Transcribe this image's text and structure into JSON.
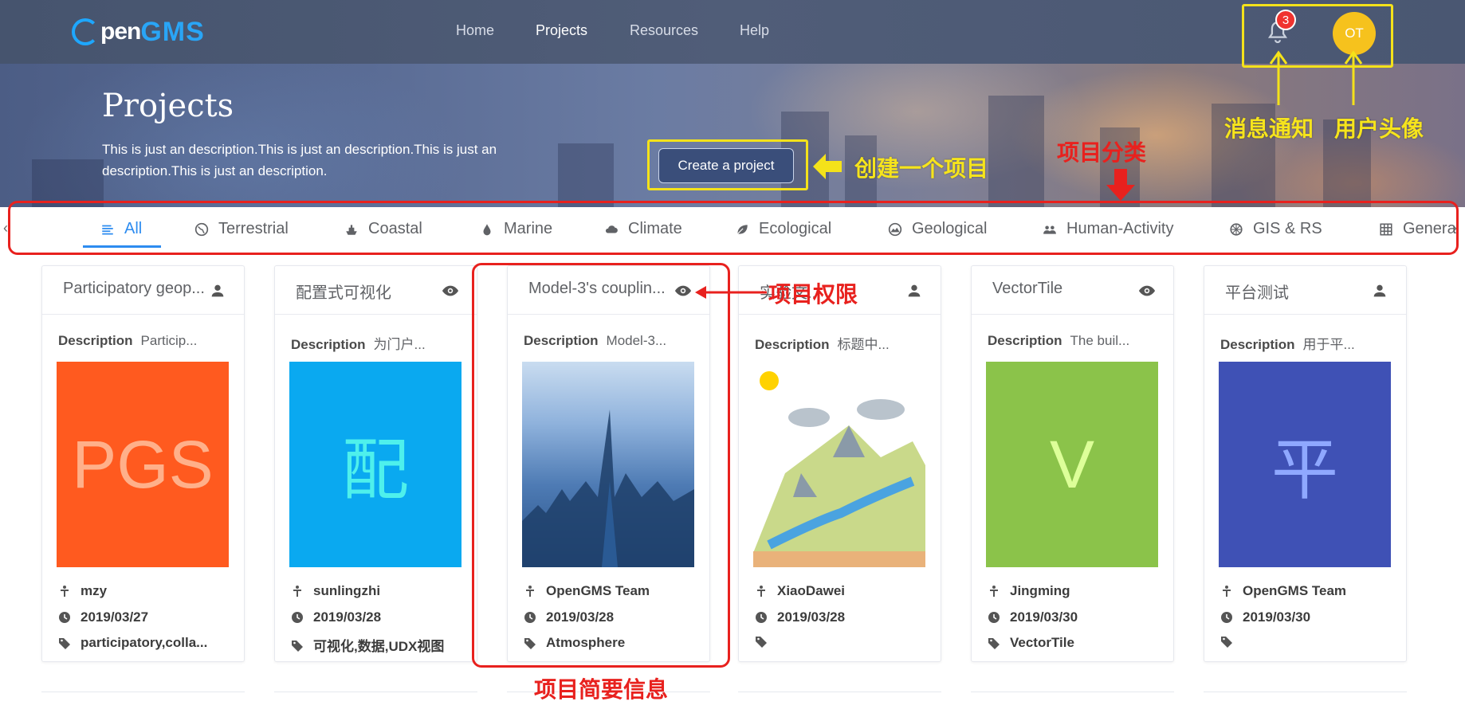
{
  "brand": {
    "logo_left": "pen",
    "logo_right": "GMS"
  },
  "nav": {
    "items": [
      {
        "label": "Home"
      },
      {
        "label": "Projects"
      },
      {
        "label": "Resources"
      },
      {
        "label": "Help"
      }
    ],
    "active": "Projects"
  },
  "notifications": {
    "count": "3"
  },
  "user": {
    "initials": "OT"
  },
  "banner": {
    "title": "Projects",
    "description": "This is just an description.This is just an description.This is just an description.This is just an description.",
    "create_button": "Create a project"
  },
  "categories": {
    "active": "All",
    "items": [
      {
        "label": "All",
        "icon": "list-icon"
      },
      {
        "label": "Terrestrial",
        "icon": "globe-icon"
      },
      {
        "label": "Coastal",
        "icon": "ship-icon"
      },
      {
        "label": "Marine",
        "icon": "water-drop-icon"
      },
      {
        "label": "Climate",
        "icon": "cloud-icon"
      },
      {
        "label": "Ecological",
        "icon": "leaf-icon"
      },
      {
        "label": "Geological",
        "icon": "mountain-icon"
      },
      {
        "label": "Human-Activity",
        "icon": "people-icon"
      },
      {
        "label": "GIS & RS",
        "icon": "satellite-icon"
      },
      {
        "label": "Genera",
        "icon": "grid-icon"
      }
    ]
  },
  "labels": {
    "description": "Description"
  },
  "projects": [
    {
      "title": "Participatory geop...",
      "permission": "private",
      "description": "Particip...",
      "thumb_text": "PGS",
      "thumb_bg": "#ff5a1f",
      "thumb_fg": "#ffb08a",
      "author": "mzy",
      "date": "2019/03/27",
      "tags": "participatory,colla..."
    },
    {
      "title": "配置式可视化",
      "permission": "public",
      "description": "为门户...",
      "thumb_text": "配",
      "thumb_bg": "#0aa9f0",
      "thumb_fg": "#4ef0ec",
      "author": "sunlingzhi",
      "date": "2019/03/28",
      "tags": "可视化,数据,UDX视图"
    },
    {
      "title": "Model-3's couplin...",
      "permission": "public",
      "description": "Model-3...",
      "thumb_text": "",
      "thumb_bg": "#6c95c8",
      "thumb_fg": "#ffffff",
      "author": "OpenGMS Team",
      "date": "2019/03/28",
      "tags": "Atmosphere"
    },
    {
      "title": "实验文...",
      "permission": "private",
      "description": "标题中...",
      "thumb_text": "",
      "thumb_bg": "#dfe9c6",
      "thumb_fg": "#ffffff",
      "author": "XiaoDawei",
      "date": "2019/03/28",
      "tags": ""
    },
    {
      "title": "VectorTile",
      "permission": "public",
      "description": "The buil...",
      "thumb_text": "V",
      "thumb_bg": "#8bc34a",
      "thumb_fg": "#ddff99",
      "author": "Jingming",
      "date": "2019/03/30",
      "tags": "VectorTile"
    },
    {
      "title": "平台测试",
      "permission": "private",
      "description": "用于平...",
      "thumb_text": "平",
      "thumb_bg": "#3f51b5",
      "thumb_fg": "#8fa8ff",
      "author": "OpenGMS Team",
      "date": "2019/03/30",
      "tags": ""
    }
  ],
  "annotations": {
    "notification": "消息通知",
    "avatar": "用户头像",
    "create": "创建一个项目",
    "category": "项目分类",
    "permission": "项目权限",
    "brief": "项目简要信息"
  },
  "colors": {
    "accent": "#2d8cf0",
    "highlight_yellow": "#f4e21a",
    "highlight_red": "#e8211e",
    "nav_bg": "#4a5772"
  }
}
